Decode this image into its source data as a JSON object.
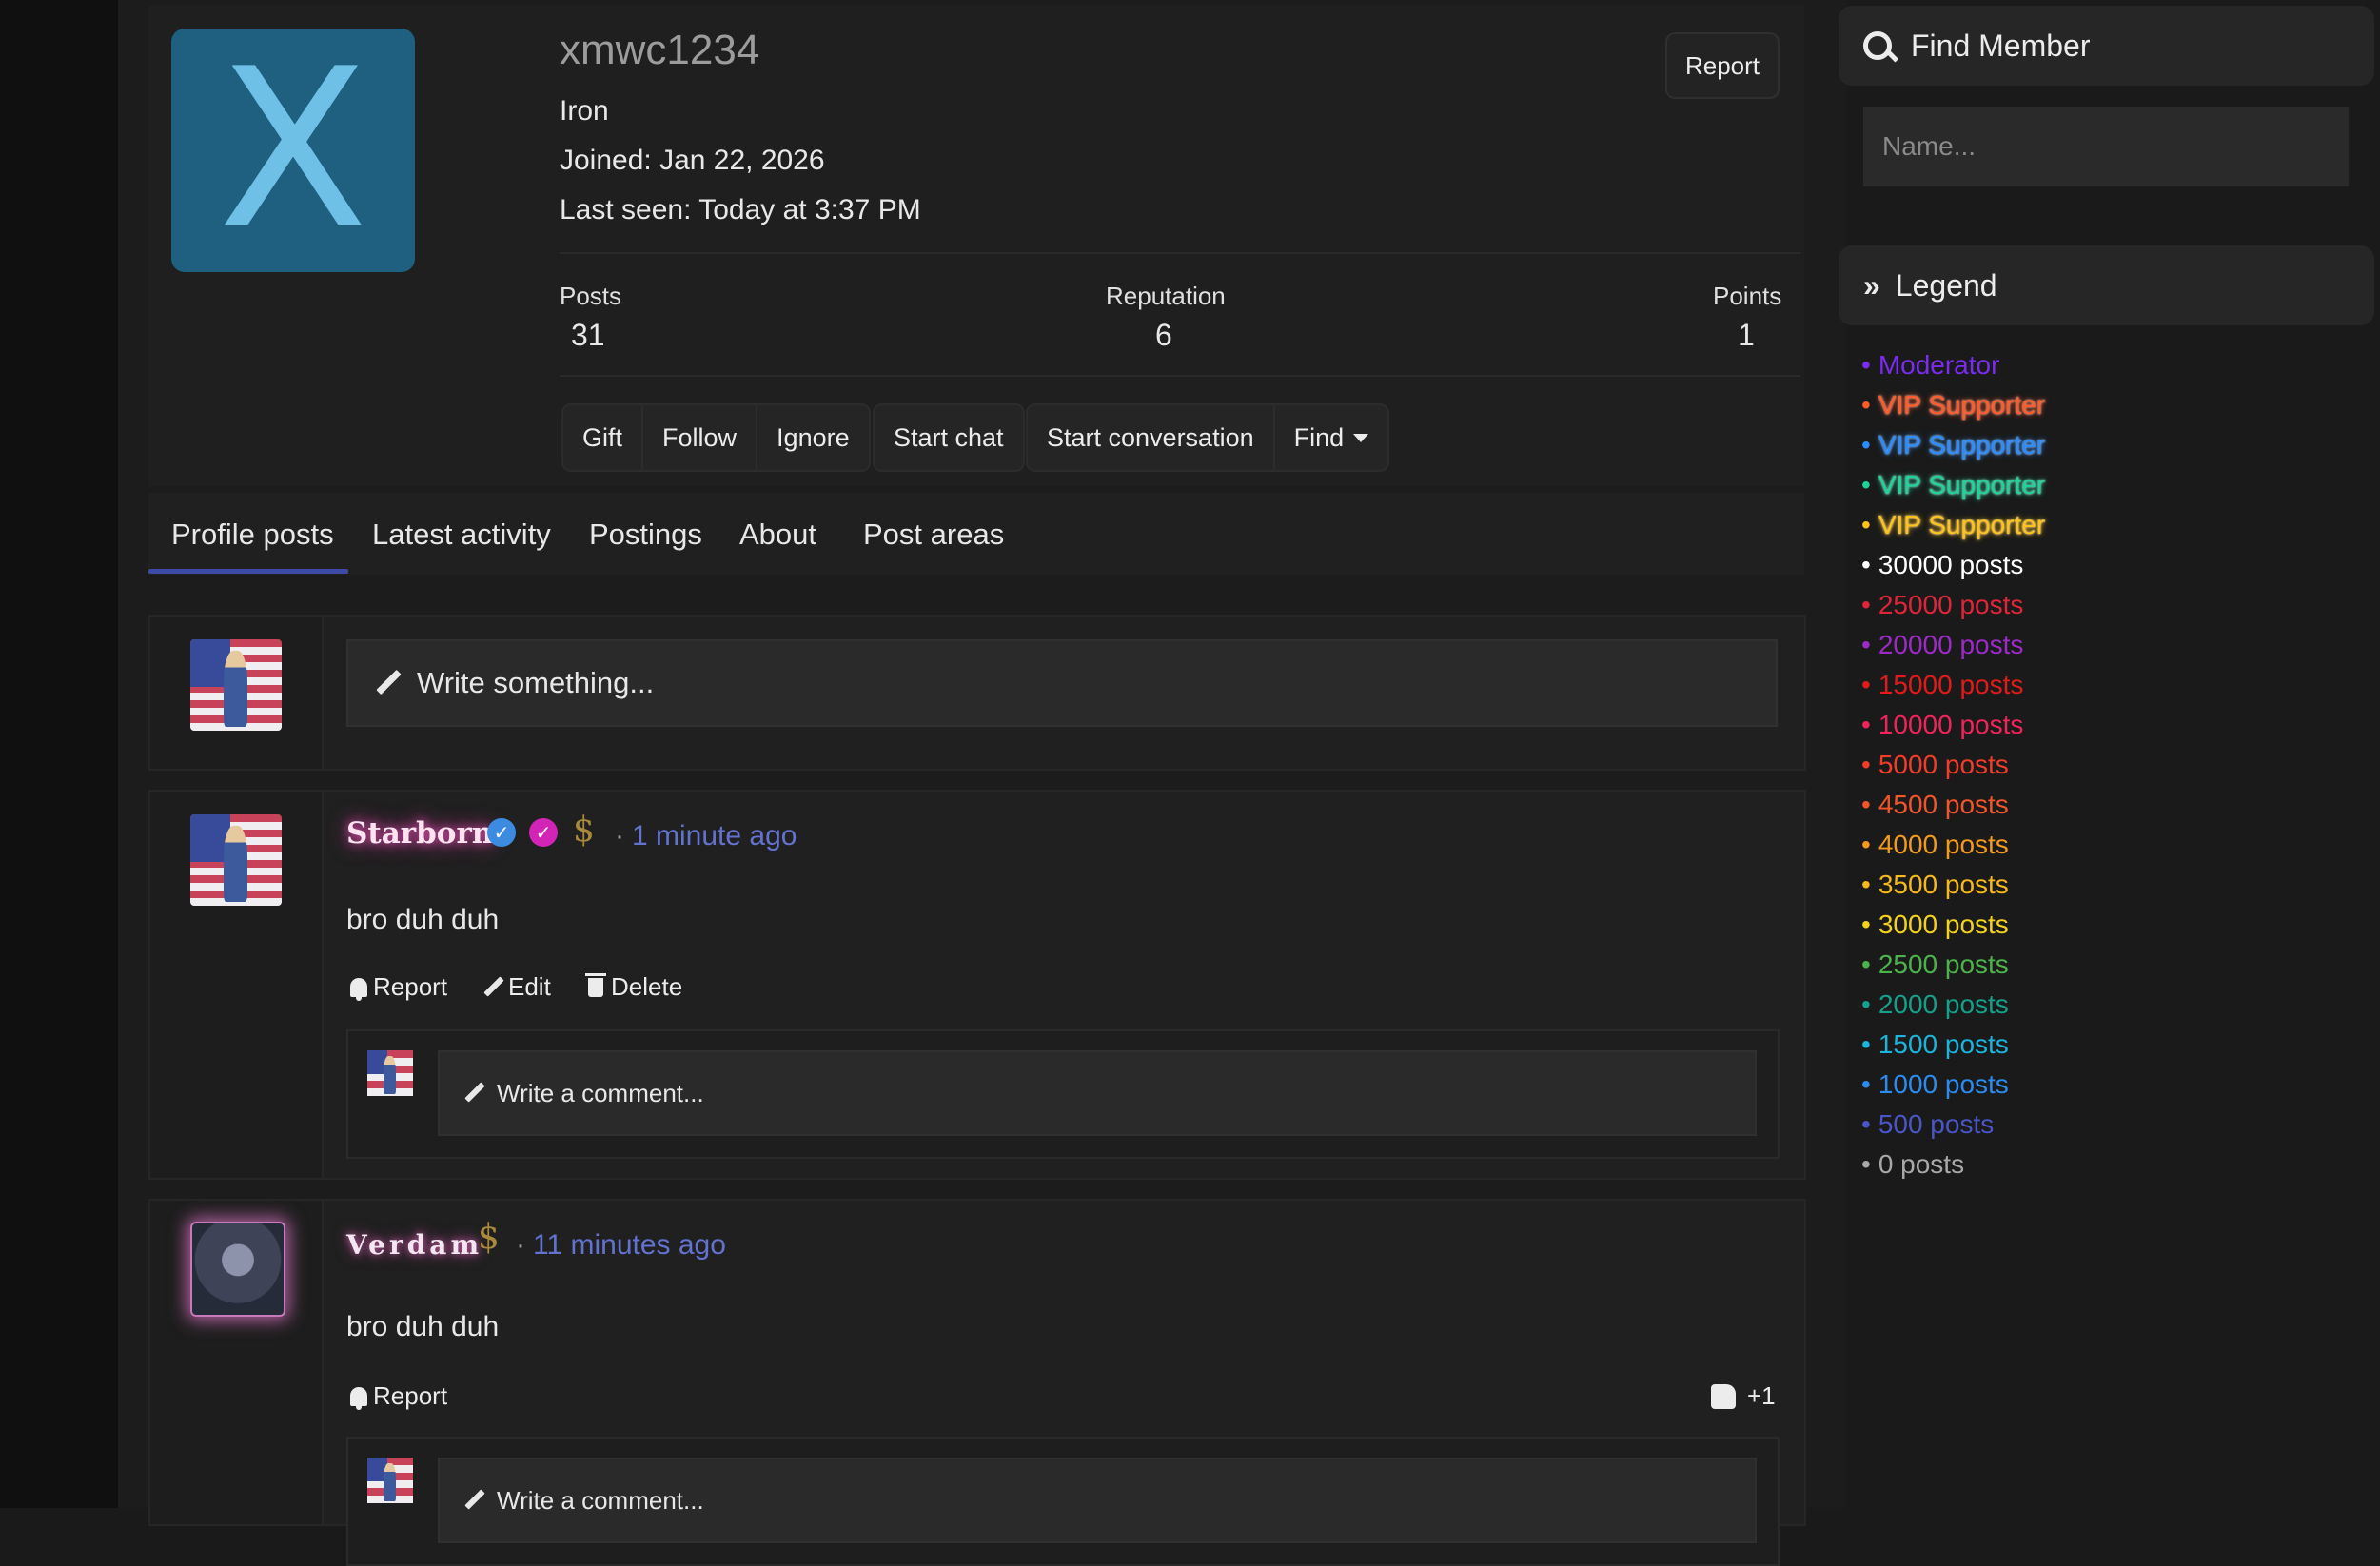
{
  "profile": {
    "username": "xmwc1234",
    "avatar_letter": "X",
    "rank": "Iron",
    "joined": "Joined: Jan 22, 2026",
    "last_seen": "Last seen: Today at 3:37 PM",
    "report_label": "Report",
    "stats": [
      {
        "label": "Posts",
        "value": "31"
      },
      {
        "label": "Reputation",
        "value": "6"
      },
      {
        "label": "Points",
        "value": "1"
      }
    ],
    "buttons_a": [
      "Gift",
      "Follow",
      "Ignore"
    ],
    "button_chat": "Start chat",
    "buttons_b": [
      "Start conversation",
      "Find"
    ]
  },
  "tabs": [
    "Profile posts",
    "Latest activity",
    "Postings",
    "About",
    "Post areas"
  ],
  "composer": {
    "placeholder": "Write something..."
  },
  "posts": [
    {
      "author": "Starborn",
      "time": "1 minute ago",
      "text": "bro duh duh",
      "actions": [
        "Report",
        "Edit",
        "Delete"
      ],
      "comment_placeholder": "Write a comment..."
    },
    {
      "author": "Verdam",
      "time": "11 minutes ago",
      "text": "bro duh duh",
      "actions": [
        "Report"
      ],
      "reaction": "+1",
      "comment_placeholder": "Write a comment..."
    }
  ],
  "sidebar": {
    "find_member_title": "Find Member",
    "name_placeholder": "Name...",
    "legend_title": "Legend",
    "legend": [
      {
        "label": "Moderator",
        "color": "#7a2cf0"
      },
      {
        "label": "VIP Supporter",
        "color": "#ff5a2a"
      },
      {
        "label": "VIP Supporter",
        "color": "#2a8cff"
      },
      {
        "label": "VIP Supporter",
        "color": "#1fd29a"
      },
      {
        "label": "VIP Supporter",
        "color": "#ffc21a"
      },
      {
        "label": "30000 posts",
        "color": "#ffffff"
      },
      {
        "label": "25000 posts",
        "color": "#e0243a"
      },
      {
        "label": "20000 posts",
        "color": "#9c2ac8"
      },
      {
        "label": "15000 posts",
        "color": "#e21a1a"
      },
      {
        "label": "10000 posts",
        "color": "#f0245a"
      },
      {
        "label": "5000 posts",
        "color": "#f23c2a"
      },
      {
        "label": "4500 posts",
        "color": "#f4542a"
      },
      {
        "label": "4000 posts",
        "color": "#f49a1a"
      },
      {
        "label": "3500 posts",
        "color": "#f6b81a"
      },
      {
        "label": "3000 posts",
        "color": "#f2d21a"
      },
      {
        "label": "2500 posts",
        "color": "#4cb34c"
      },
      {
        "label": "2000 posts",
        "color": "#14a08a"
      },
      {
        "label": "1500 posts",
        "color": "#1ab4dc"
      },
      {
        "label": "1000 posts",
        "color": "#2a8cf0"
      },
      {
        "label": "500 posts",
        "color": "#4a56c8"
      },
      {
        "label": "0 posts",
        "color": "#a8a8a8"
      }
    ]
  }
}
